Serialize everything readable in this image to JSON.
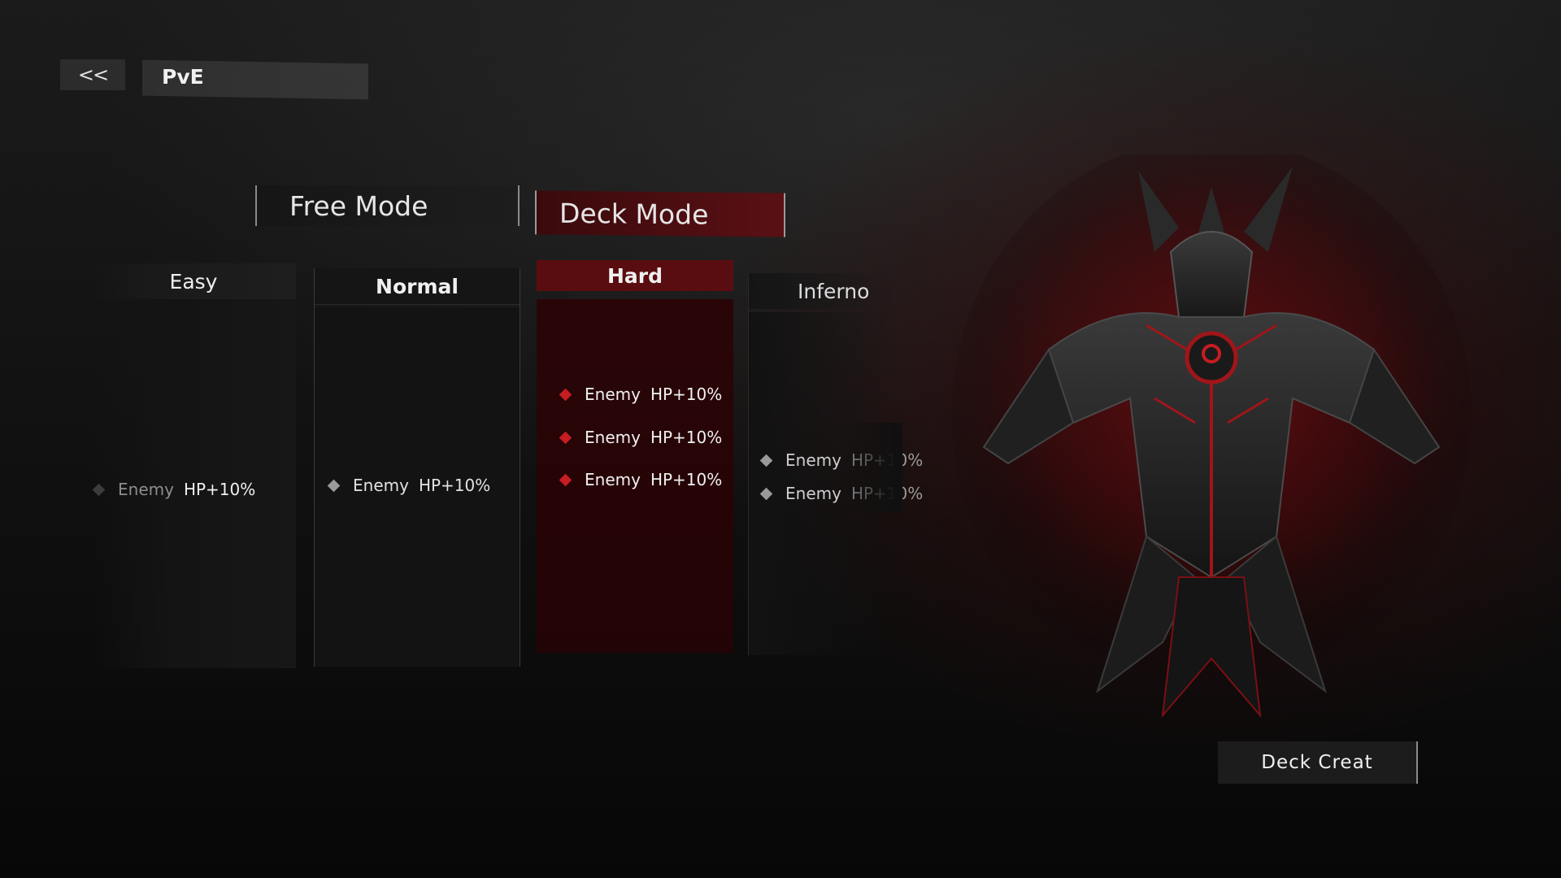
{
  "header": {
    "back_label": "<<",
    "title": "PvE"
  },
  "mode_tabs": [
    {
      "label": "Free Mode",
      "selected": false
    },
    {
      "label": "Deck Mode",
      "selected": true
    }
  ],
  "difficulties": [
    {
      "name": "Easy",
      "selected": false,
      "effects": [
        {
          "label": "Enemy",
          "value": "HP+10%"
        }
      ]
    },
    {
      "name": "Normal",
      "selected": false,
      "effects": [
        {
          "label": "Enemy",
          "value": "HP+10%"
        }
      ]
    },
    {
      "name": "Hard",
      "selected": true,
      "effects": [
        {
          "label": "Enemy",
          "value": "HP+10%"
        },
        {
          "label": "Enemy",
          "value": "HP+10%"
        },
        {
          "label": "Enemy",
          "value": "HP+10%"
        }
      ]
    },
    {
      "name": "Inferno",
      "selected": false,
      "effects": [
        {
          "label": "Enemy",
          "value": "HP+10%"
        },
        {
          "label": "Enemy",
          "value": "HP+10%"
        }
      ]
    }
  ],
  "actions": {
    "deck_create_label": "Deck Creat"
  },
  "colors": {
    "accent_red": "#c51d22",
    "selected_tab_bg": "#5a1014",
    "background": "#0a0a0a"
  }
}
